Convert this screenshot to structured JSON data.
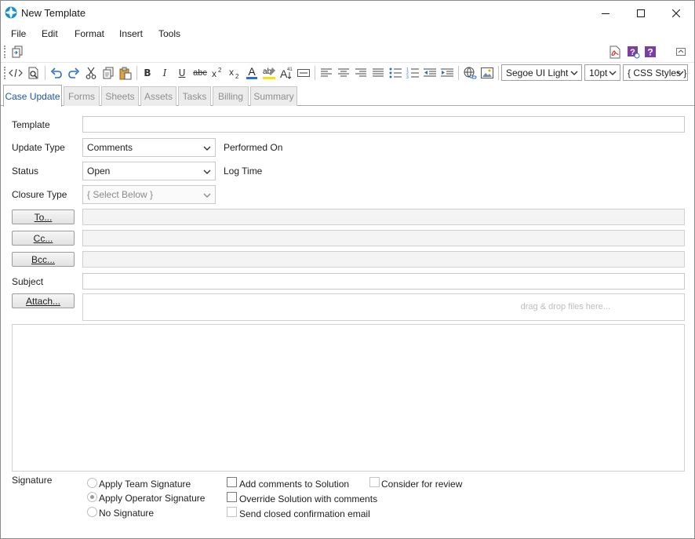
{
  "window": {
    "title": "New Template",
    "accent": "#1a56b8"
  },
  "menu": [
    "File",
    "Edit",
    "Format",
    "Insert",
    "Tools"
  ],
  "toolbar": {
    "font_name": "Segoe UI Light",
    "font_size": "10pt",
    "css_styles": "{ CSS Styles }"
  },
  "tabs": [
    {
      "label": "Case Update",
      "active": true
    },
    {
      "label": "Forms",
      "active": false
    },
    {
      "label": "Sheets",
      "active": false
    },
    {
      "label": "Assets",
      "active": false
    },
    {
      "label": "Tasks",
      "active": false
    },
    {
      "label": "Billing",
      "active": false
    },
    {
      "label": "Summary",
      "active": false
    }
  ],
  "form": {
    "template_label": "Template",
    "template_value": "",
    "update_type_label": "Update Type",
    "update_type_value": "Comments",
    "performed_on_label": "Performed On",
    "status_label": "Status",
    "status_value": "Open",
    "log_time_label": "Log Time",
    "closure_type_label": "Closure Type",
    "closure_type_value": "{ Select Below }",
    "to_button": "To...",
    "cc_button": "Cc...",
    "bcc_button": "Bcc...",
    "subject_label": "Subject",
    "attach_button": "Attach...",
    "drop_hint": "drag & drop files here..."
  },
  "signature": {
    "label": "Signature",
    "options": [
      {
        "label": "Apply Team Signature",
        "selected": false
      },
      {
        "label": "Apply Operator Signature",
        "selected": true
      },
      {
        "label": "No Signature",
        "selected": false
      }
    ],
    "checks": [
      {
        "label": "Add comments to Solution",
        "checked": false
      },
      {
        "label": "Override Solution with comments",
        "checked": false
      },
      {
        "label": "Send closed confirmation email",
        "checked": false
      },
      {
        "label": "Consider for review",
        "checked": false
      }
    ]
  }
}
